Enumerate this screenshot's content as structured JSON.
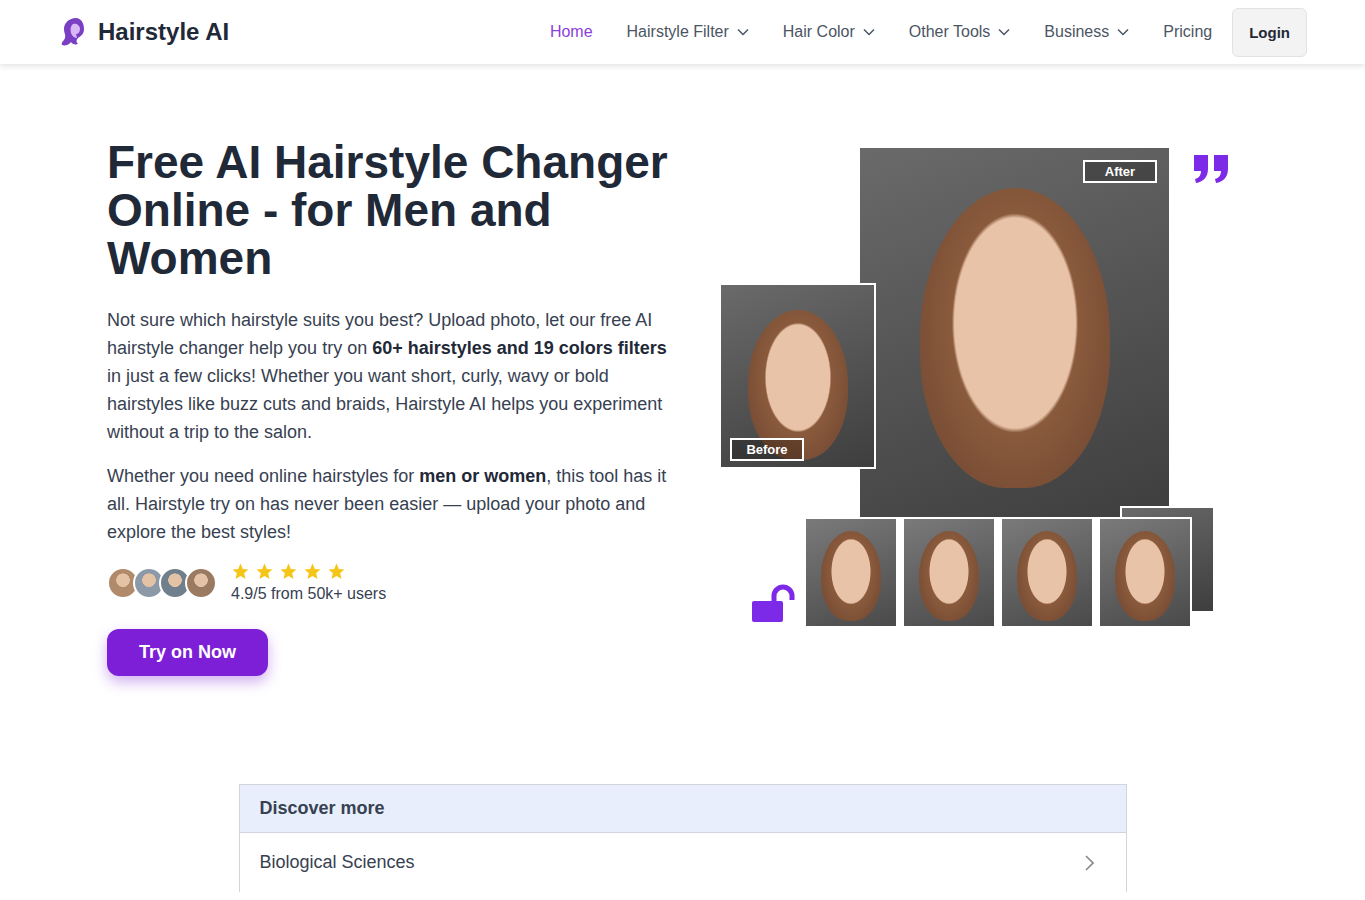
{
  "logo": {
    "text": "Hairstyle AI"
  },
  "nav": [
    {
      "label": "Home",
      "selected": true,
      "dropdown": false
    },
    {
      "label": "Hairstyle Filter",
      "selected": false,
      "dropdown": true
    },
    {
      "label": "Hair Color",
      "selected": false,
      "dropdown": true
    },
    {
      "label": "Other Tools",
      "selected": false,
      "dropdown": true
    },
    {
      "label": "Business",
      "selected": false,
      "dropdown": true
    },
    {
      "label": "Pricing",
      "selected": false,
      "dropdown": false
    }
  ],
  "login": "Login",
  "hero": {
    "title": "Free AI Hairstyle Changer Online - for Men and Women",
    "paragraphs": [
      [
        {
          "text": "Not sure which hairstyle suits you best? Upload photo, let our free AI hairstyle changer help you try on ",
          "bold": false
        },
        {
          "text": "60+ hairstyles and 19 colors filters",
          "bold": true
        },
        {
          "text": " in just a few clicks! Whether you want short, curly, wavy or bold hairstyles like buzz cuts and braids, Hairstyle AI helps you experiment without a trip to the salon.",
          "bold": false
        }
      ],
      [
        {
          "text": "Whether you need online hairstyles for ",
          "bold": false
        },
        {
          "text": "men or women",
          "bold": true
        },
        {
          "text": ", this tool has it all. Hairstyle try on has never been easier — upload your photo and explore the best styles!",
          "bold": false
        }
      ]
    ],
    "rating": {
      "avatars": 4,
      "stars": 5,
      "text": "4.9/5 from 50k+ users"
    },
    "cta": "Try on Now"
  },
  "collage": {
    "after_label": "After",
    "before_label": "Before",
    "thumbnails": 5
  },
  "discover": {
    "title": "Discover more",
    "items": [
      {
        "label": "Biological Sciences"
      }
    ]
  }
}
